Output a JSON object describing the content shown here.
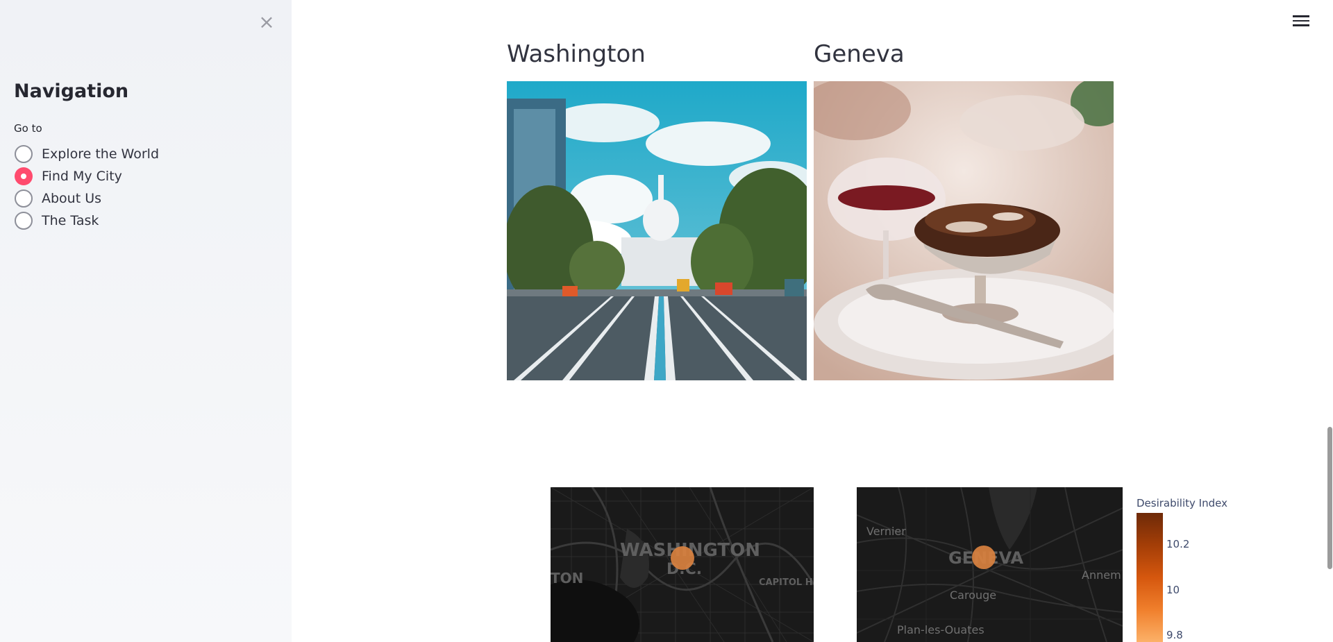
{
  "sidebar": {
    "title": "Navigation",
    "goto_label": "Go to",
    "options": [
      {
        "label": "Explore the World",
        "selected": false
      },
      {
        "label": "Find My City",
        "selected": true
      },
      {
        "label": "About Us",
        "selected": false
      },
      {
        "label": "The Task",
        "selected": false
      }
    ],
    "close_icon": "close-icon"
  },
  "header": {
    "menu_icon": "hamburger-menu-icon"
  },
  "cities": [
    {
      "name": "Washington",
      "photo": "capitol-street-photo"
    },
    {
      "name": "Geneva",
      "photo": "dessert-wine-photo"
    }
  ],
  "maps": {
    "washington": {
      "labels": [
        "WASHINGTON",
        "D.C.",
        "TON",
        "CAPITOL HI"
      ]
    },
    "geneva": {
      "labels": [
        "GENEVA",
        "Vernier",
        "Carouge",
        "Annem",
        "Plan-les-Ouates"
      ]
    }
  },
  "colorbar": {
    "title": "Desirability Index",
    "ticks": [
      "10.2",
      "10",
      "9.8"
    ],
    "colors": [
      "#6e2a08",
      "#d5570e",
      "#fcb168"
    ]
  }
}
